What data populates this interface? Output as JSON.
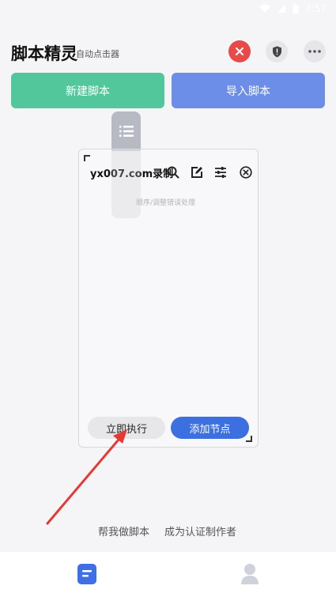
{
  "status_bar": {
    "time": "3:57"
  },
  "header": {
    "title": "脚本精灵",
    "subtitle": "自动点击器",
    "icons": [
      "close-icon",
      "shield-icon",
      "more-icon"
    ]
  },
  "actions": {
    "new_script": "新建脚本",
    "import_script": "导入脚本"
  },
  "floating_panel": {
    "title": "yx007.com录制",
    "tools": [
      "search-icon",
      "edit-icon",
      "settings-sliders-icon",
      "close-circle-icon"
    ],
    "hint": "顺序/调整错误处理",
    "run_now": "立即执行",
    "add_node": "添加节点"
  },
  "footer": {
    "help_make": "帮我做脚本",
    "become_author": "成为认证制作者"
  },
  "bottom_nav": {
    "items": [
      "script-tab-icon",
      "profile-tab-icon"
    ]
  },
  "colors": {
    "close_red": "#e84a4a",
    "new_green": "#52c79b",
    "import_blue": "#6c8de8",
    "add_node_blue": "#3c6fe0",
    "arrow_red": "#e53935"
  }
}
